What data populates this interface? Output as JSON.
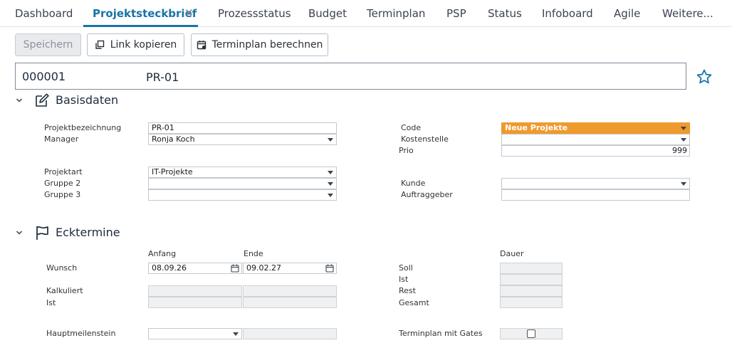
{
  "tabs": [
    {
      "label": "Dashboard"
    },
    {
      "label": "Projektsteckbrief"
    },
    {
      "label": "Prozessstatus"
    },
    {
      "label": "Budget"
    },
    {
      "label": "Terminplan"
    },
    {
      "label": "PSP"
    },
    {
      "label": "Status"
    },
    {
      "label": "Infoboard"
    },
    {
      "label": "Agile"
    },
    {
      "label": "Weitere..."
    }
  ],
  "toolbar": {
    "save_label": "Speichern",
    "copy_link_label": "Link kopieren",
    "schedule_label": "Terminplan berechnen"
  },
  "header": {
    "id": "000001",
    "name": "PR-01"
  },
  "basisdaten": {
    "title": "Basisdaten",
    "projektbezeichnung_label": "Projektbezeichnung",
    "projektbezeichnung_value": "PR-01",
    "manager_label": "Manager",
    "manager_value": "Ronja Koch",
    "projektart_label": "Projektart",
    "projektart_value": "IT-Projekte",
    "gruppe2_label": "Gruppe 2",
    "gruppe2_value": "",
    "gruppe3_label": "Gruppe 3",
    "gruppe3_value": "",
    "code_label": "Code",
    "code_value": "Neue Projekte",
    "code_color": "#ef9a2d",
    "kostenstelle_label": "Kostenstelle",
    "kostenstelle_value": "",
    "prio_label": "Prio",
    "prio_value": "999",
    "kunde_label": "Kunde",
    "kunde_value": "",
    "auftraggeber_label": "Auftraggeber",
    "auftraggeber_value": ""
  },
  "ecktermine": {
    "title": "Ecktermine",
    "anfang_header": "Anfang",
    "ende_header": "Ende",
    "dauer_header": "Dauer",
    "wunsch_label": "Wunsch",
    "wunsch_anfang": "08.09.26",
    "wunsch_ende": "09.02.27",
    "kalkuliert_label": "Kalkuliert",
    "ist_label": "Ist",
    "hauptmeilenstein_label": "Hauptmeilenstein",
    "soll_label": "Soll",
    "ist_right_label": "Ist",
    "rest_label": "Rest",
    "gesamt_label": "Gesamt",
    "terminplan_gates_label": "Terminplan mit Gates",
    "terminplan_gates_checked": false
  },
  "icons": {
    "close": "close-icon",
    "copy": "copy-icon",
    "calendar": "calendar-icon",
    "star": "star-icon",
    "edit": "edit-icon",
    "flag": "flag-icon",
    "chevron": "chevron-down-icon"
  },
  "colors": {
    "accent": "#1a73a8",
    "code_orange": "#ef9a2d"
  }
}
